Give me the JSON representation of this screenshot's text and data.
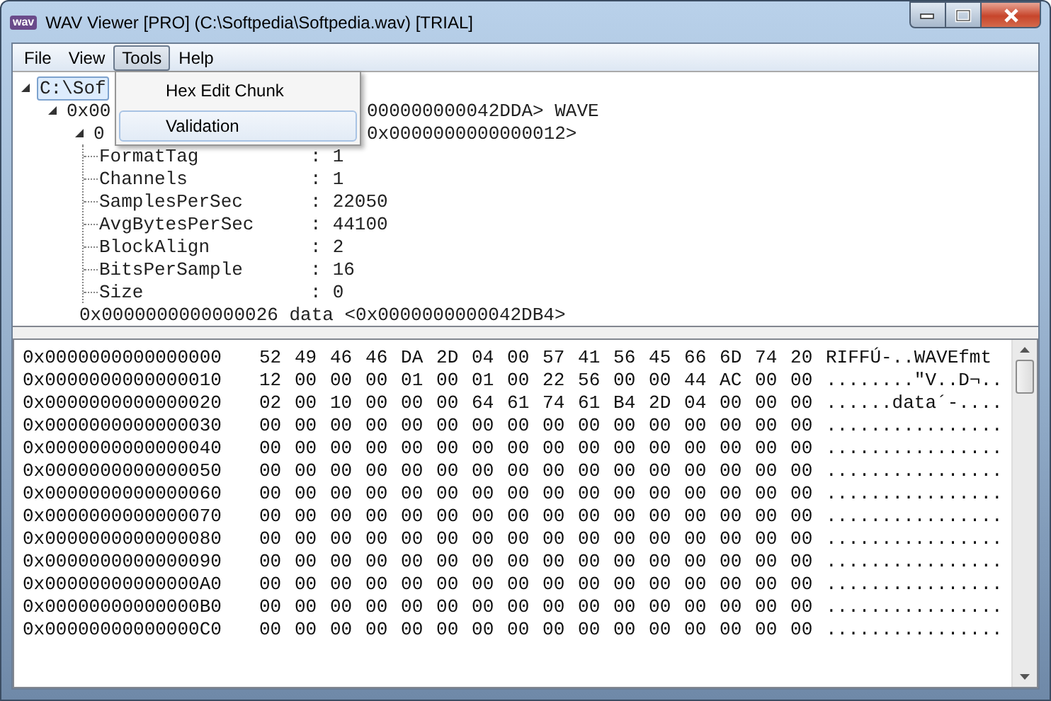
{
  "window": {
    "app_icon": "wav",
    "title": "WAV Viewer [PRO] (C:\\Softpedia\\Softpedia.wav) [TRIAL]"
  },
  "menu": [
    {
      "label": "File",
      "selected": false
    },
    {
      "label": "View",
      "selected": false
    },
    {
      "label": "Tools",
      "selected": true
    },
    {
      "label": "Help",
      "selected": false
    }
  ],
  "dropdown": [
    {
      "label": "Hex Edit Chunk",
      "selected": false
    },
    {
      "label": "Validation",
      "selected": true
    }
  ],
  "tree": [
    {
      "parts": [
        "C:\\Sof"
      ],
      "selected": true,
      "expanded": true,
      "children": [
        {
          "parts": [
            "0x00",
            "000000000042DDA> WAVE"
          ],
          "selected": false,
          "expanded": true,
          "children": [
            {
              "parts": [
                "0",
                "0x0000000000000012>"
              ],
              "selected": false,
              "expanded": true,
              "fields": [
                {
                  "name": "FormatTag",
                  "separator": ":",
                  "value": "1"
                },
                {
                  "name": "Channels",
                  "separator": ":",
                  "value": "1"
                },
                {
                  "name": "SamplesPerSec",
                  "separator": ":",
                  "value": "22050"
                },
                {
                  "name": "AvgBytesPerSec",
                  "separator": ":",
                  "value": "44100"
                },
                {
                  "name": "BlockAlign",
                  "separator": ":",
                  "value": "2"
                },
                {
                  "name": "BitsPerSample",
                  "separator": ":",
                  "value": "16"
                },
                {
                  "name": "Size",
                  "separator": ":",
                  "value": "0"
                }
              ]
            },
            {
              "parts": [
                "0x0000000000000026 data <0x0000000000042DB4>"
              ],
              "selected": false
            }
          ]
        }
      ]
    }
  ],
  "hex_rows": [
    {
      "offset": "0x0000000000000000",
      "bytes": "52 49 46 46 DA 2D 04 00 57 41 56 45 66 6D 74 20",
      "ascii": "RIFFÚ-..WAVEfmt "
    },
    {
      "offset": "0x0000000000000010",
      "bytes": "12 00 00 00 01 00 01 00 22 56 00 00 44 AC 00 00",
      "ascii": "........\"V..D¬.."
    },
    {
      "offset": "0x0000000000000020",
      "bytes": "02 00 10 00 00 00 64 61 74 61 B4 2D 04 00 00 00",
      "ascii": "......data´-...."
    },
    {
      "offset": "0x0000000000000030",
      "bytes": "00 00 00 00 00 00 00 00 00 00 00 00 00 00 00 00",
      "ascii": "................"
    },
    {
      "offset": "0x0000000000000040",
      "bytes": "00 00 00 00 00 00 00 00 00 00 00 00 00 00 00 00",
      "ascii": "................"
    },
    {
      "offset": "0x0000000000000050",
      "bytes": "00 00 00 00 00 00 00 00 00 00 00 00 00 00 00 00",
      "ascii": "................"
    },
    {
      "offset": "0x0000000000000060",
      "bytes": "00 00 00 00 00 00 00 00 00 00 00 00 00 00 00 00",
      "ascii": "................"
    },
    {
      "offset": "0x0000000000000070",
      "bytes": "00 00 00 00 00 00 00 00 00 00 00 00 00 00 00 00",
      "ascii": "................"
    },
    {
      "offset": "0x0000000000000080",
      "bytes": "00 00 00 00 00 00 00 00 00 00 00 00 00 00 00 00",
      "ascii": "................"
    },
    {
      "offset": "0x0000000000000090",
      "bytes": "00 00 00 00 00 00 00 00 00 00 00 00 00 00 00 00",
      "ascii": "................"
    },
    {
      "offset": "0x00000000000000A0",
      "bytes": "00 00 00 00 00 00 00 00 00 00 00 00 00 00 00 00",
      "ascii": "................"
    },
    {
      "offset": "0x00000000000000B0",
      "bytes": "00 00 00 00 00 00 00 00 00 00 00 00 00 00 00 00",
      "ascii": "................"
    },
    {
      "offset": "0x00000000000000C0",
      "bytes": "00 00 00 00 00 00 00 00 00 00 00 00 00 00 00 00",
      "ascii": "................"
    }
  ]
}
